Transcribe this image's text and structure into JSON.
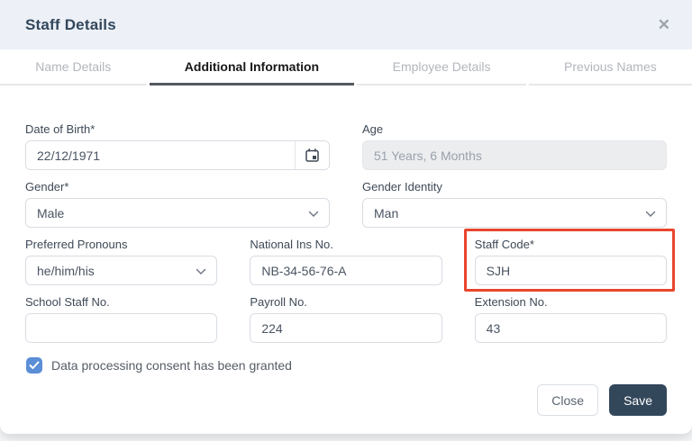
{
  "modal": {
    "title": "Staff Details",
    "close_icon": "✕"
  },
  "tabs": [
    {
      "label": "Name Details",
      "active": false
    },
    {
      "label": "Additional Information",
      "active": true
    },
    {
      "label": "Employee Details",
      "active": false
    },
    {
      "label": "Previous Names",
      "active": false
    }
  ],
  "form": {
    "date_of_birth": {
      "label": "Date of Birth*",
      "value": "22/12/1971",
      "icon": "calendar-icon"
    },
    "age": {
      "label": "Age",
      "value": "51 Years, 6 Months",
      "disabled": true
    },
    "gender": {
      "label": "Gender*",
      "value": "Male"
    },
    "gender_identity": {
      "label": "Gender Identity",
      "value": "Man"
    },
    "preferred_pronouns": {
      "label": "Preferred Pronouns",
      "value": "he/him/his"
    },
    "national_ins_no": {
      "label": "National Ins No.",
      "value": "NB-34-56-76-A"
    },
    "staff_code": {
      "label": "Staff Code*",
      "value": "SJH",
      "highlighted": true
    },
    "school_staff_no": {
      "label": "School Staff No.",
      "value": ""
    },
    "payroll_no": {
      "label": "Payroll No.",
      "value": "224"
    },
    "extension_no": {
      "label": "Extension No.",
      "value": "43"
    },
    "consent_checkbox": {
      "label": "Data processing consent has been granted",
      "checked": true
    }
  },
  "footer": {
    "close_label": "Close",
    "save_label": "Save"
  },
  "colors": {
    "header_bg": "#edf1f7",
    "title_text": "#33475b",
    "highlight_red": "#e8462d",
    "checkbox_blue": "#5a8ed6",
    "save_button_bg": "#33475b"
  }
}
